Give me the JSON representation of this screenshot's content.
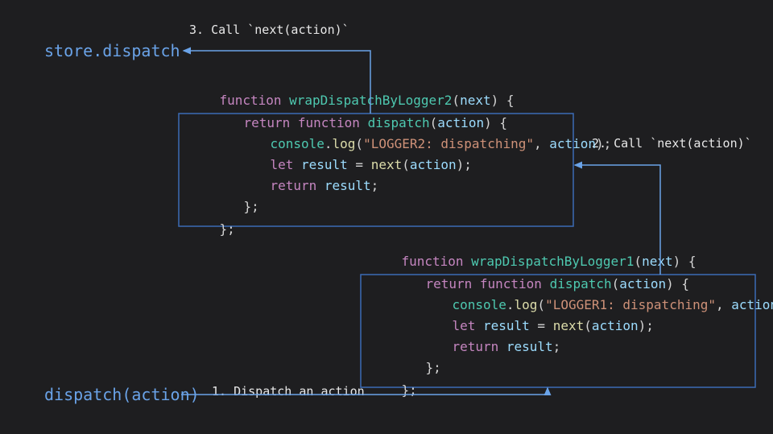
{
  "labels": {
    "store_dispatch": "store.dispatch",
    "dispatch_action": "dispatch(action)"
  },
  "annotations": {
    "step1": "1. Dispatch an action",
    "step2": "2. Call `next(action)`",
    "step3": "3. Call `next(action)`"
  },
  "code": {
    "block2": {
      "l1": {
        "kw": "function",
        "fn": " wrapDispatchByLogger2",
        "plain1": "(",
        "param": "next",
        "plain2": ") {"
      },
      "l2": {
        "kw1": "return",
        "kw2": " function",
        "fn": " dispatch",
        "plain1": "(",
        "param": "action",
        "plain2": ") {"
      },
      "l3": {
        "obj": "console",
        "dot": ".",
        "call": "log",
        "open": "(",
        "str": "\"LOGGER2: dispatching\"",
        "comma": ", ",
        "param": "action",
        "close": ");"
      },
      "l4": {
        "kw": "let",
        "var": " result",
        "eq": " = ",
        "call": "next",
        "open": "(",
        "param": "action",
        "close": ");"
      },
      "l5": {
        "kw": "return",
        "var": " result",
        "semi": ";"
      },
      "l6": {
        "close": "};"
      },
      "l7": {
        "close": "};"
      }
    },
    "block1": {
      "l1": {
        "kw": "function",
        "fn": " wrapDispatchByLogger1",
        "plain1": "(",
        "param": "next",
        "plain2": ") {"
      },
      "l2": {
        "kw1": "return",
        "kw2": " function",
        "fn": " dispatch",
        "plain1": "(",
        "param": "action",
        "plain2": ") {"
      },
      "l3": {
        "obj": "console",
        "dot": ".",
        "call": "log",
        "open": "(",
        "str": "\"LOGGER1: dispatching\"",
        "comma": ", ",
        "param": "action",
        "close": ");"
      },
      "l4": {
        "kw": "let",
        "var": " result",
        "eq": " = ",
        "call": "next",
        "open": "(",
        "param": "action",
        "close": ");"
      },
      "l5": {
        "kw": "return",
        "var": " result",
        "semi": ";"
      },
      "l6": {
        "close": "};"
      },
      "l7": {
        "close": "};"
      }
    }
  },
  "colors": {
    "arrow": "#6aa3e8",
    "box": "#3b6bb5"
  }
}
